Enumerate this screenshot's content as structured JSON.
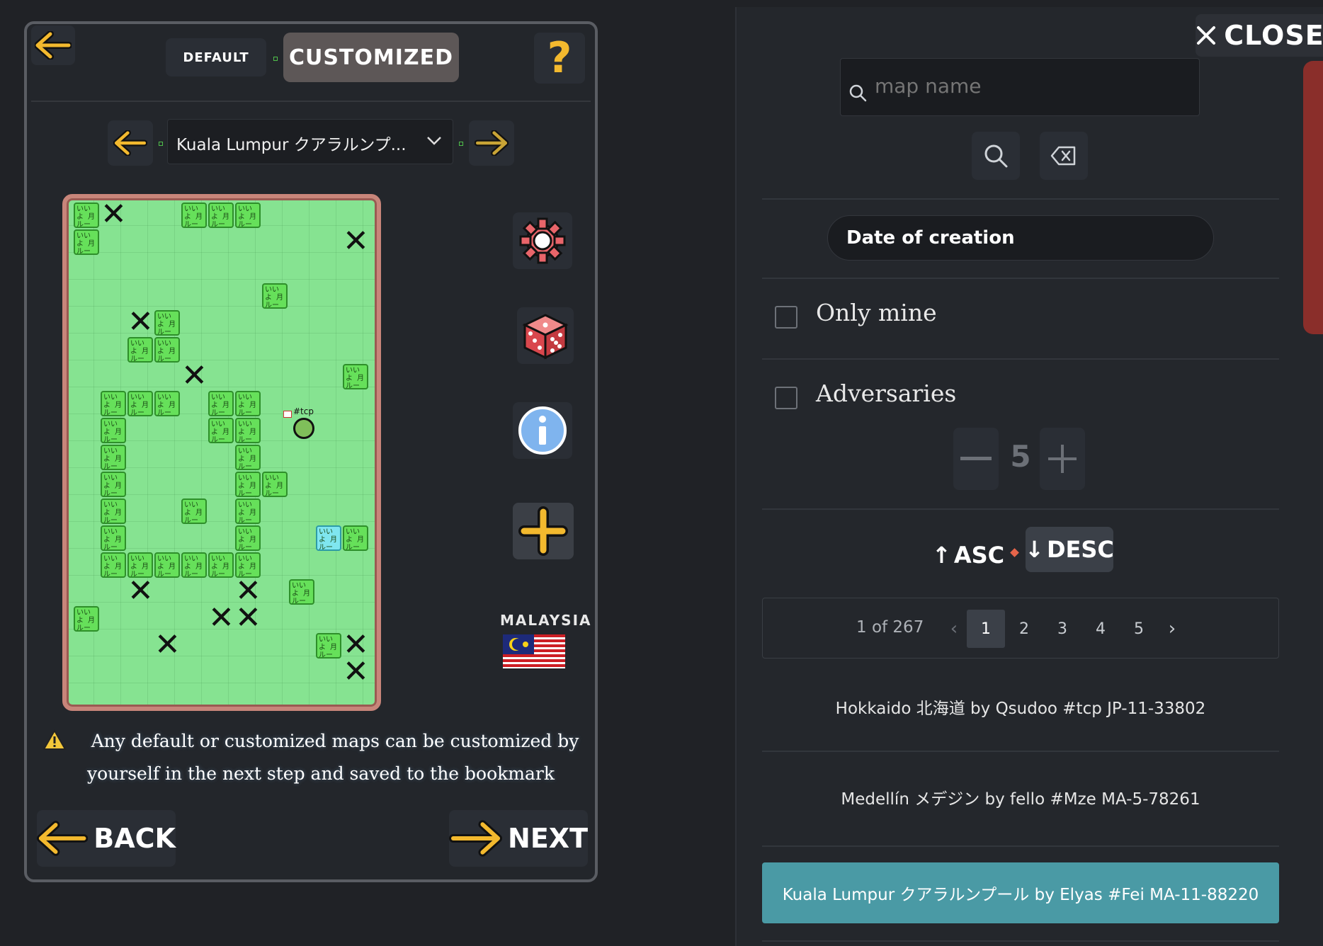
{
  "header": {
    "mode_default": "DEFAULT",
    "mode_customized": "CUSTOMIZED",
    "help_symbol": "?"
  },
  "map_select": {
    "current": "Kuala Lumpur クアラルンプ..."
  },
  "board": {
    "player_tag": "#tcp",
    "tile_text": "いいよ 月ルーブ",
    "tiles": [
      [
        0,
        0
      ],
      [
        4,
        0
      ],
      [
        5,
        0
      ],
      [
        6,
        0
      ],
      [
        0,
        1
      ],
      [
        7,
        3
      ],
      [
        3,
        4
      ],
      [
        2,
        5
      ],
      [
        3,
        5
      ],
      [
        10,
        6
      ],
      [
        1,
        7
      ],
      [
        2,
        7
      ],
      [
        3,
        7
      ],
      [
        5,
        7
      ],
      [
        6,
        7
      ],
      [
        1,
        8
      ],
      [
        5,
        8
      ],
      [
        6,
        8
      ],
      [
        1,
        9
      ],
      [
        6,
        9
      ],
      [
        1,
        10
      ],
      [
        6,
        10
      ],
      [
        7,
        10
      ],
      [
        1,
        11
      ],
      [
        4,
        11
      ],
      [
        6,
        11
      ],
      [
        1,
        12
      ],
      [
        6,
        12
      ],
      [
        10,
        12
      ],
      [
        1,
        13
      ],
      [
        2,
        13
      ],
      [
        3,
        13
      ],
      [
        4,
        13
      ],
      [
        5,
        13
      ],
      [
        6,
        13
      ],
      [
        8,
        14
      ],
      [
        0,
        15
      ],
      [
        9,
        16
      ]
    ],
    "cyan_tiles": [
      [
        9,
        12
      ]
    ],
    "x_marks": [
      [
        1,
        0
      ],
      [
        10,
        1
      ],
      [
        2,
        4
      ],
      [
        4,
        6
      ],
      [
        2,
        14
      ],
      [
        6,
        14
      ],
      [
        5,
        15
      ],
      [
        6,
        15
      ],
      [
        3,
        16
      ],
      [
        10,
        16
      ],
      [
        10,
        17
      ]
    ],
    "player": [
      8,
      8
    ]
  },
  "side_tools": {
    "settings_icon": "gear-icon",
    "random_icon": "dice-icon",
    "info_icon": "info-icon",
    "add_icon": "plus-icon",
    "country_label": "MALAYSIA",
    "country_flag": "malaysia-flag-icon"
  },
  "notice": {
    "icon": "warning-icon",
    "text": "Any default or customized maps can be customized by yourself in the next step and saved to the bookmark"
  },
  "footer": {
    "back_label": "BACK",
    "next_label": "NEXT"
  },
  "right_panel": {
    "close_label": "CLOSE",
    "search": {
      "placeholder": "map name",
      "value": ""
    },
    "sort_select": "Date of creation",
    "only_mine_label": "Only mine",
    "adversaries_label": "Adversaries",
    "adversaries_count": "5",
    "asc_label": "ASC",
    "desc_label": "DESC",
    "pagination": {
      "summary": "1 of 267",
      "pages": [
        "1",
        "2",
        "3",
        "4",
        "5"
      ],
      "current": "1"
    },
    "results": [
      "Hokkaido 北海道 by Qsudoo #tcp JP-11-33802",
      "Medellín メデジン by fello #Mze MA-5-78261",
      "Kuala Lumpur クアラルンプール by Elyas #Fei MA-11-88220"
    ]
  },
  "colors": {
    "accent_teal": "#4a9aa5",
    "board_green": "#86e391",
    "tile_green": "#66e05a",
    "arrow_yellow": "#f3b92e"
  }
}
